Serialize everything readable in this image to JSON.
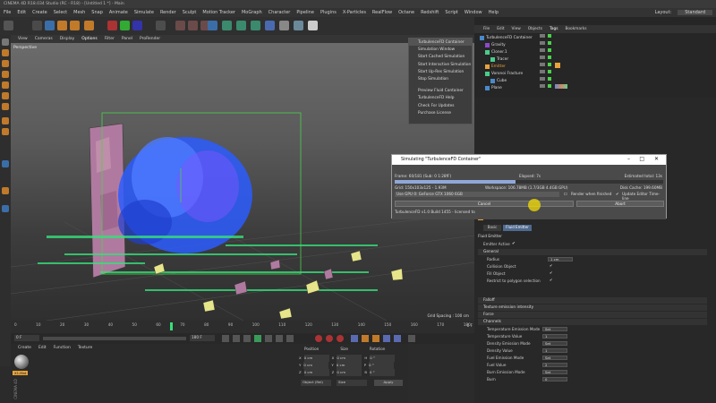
{
  "window": {
    "title": "CINEMA 4D R18.034 Studio (RC - R18) - [Untitled 1 *] - Main"
  },
  "menubar": [
    "File",
    "Edit",
    "Create",
    "Select",
    "Mesh",
    "Snap",
    "Animate",
    "Simulate",
    "Render",
    "Sculpt",
    "Motion Tracker",
    "MoGraph",
    "Character",
    "Pipeline",
    "Plugins",
    "X-Particles",
    "RealFlow",
    "Octane",
    "Redshift",
    "Script",
    "Window",
    "Help"
  ],
  "layout": {
    "label": "Layout:",
    "value": "Standard"
  },
  "viewport": {
    "menu": [
      "View",
      "Cameras",
      "Display",
      "Options",
      "Filter",
      "Panel",
      "ProRender"
    ],
    "label": "Perspective",
    "grid_spacing": "Grid Spacing : 100 cm"
  },
  "plugin_menu": {
    "items": [
      "TurbulenceFD Container",
      "Simulation Window",
      "Start Cached Simulation",
      "Start Interactive Simulation",
      "Start Up-Res Simulation",
      "Stop Simulation",
      "",
      "Preview Fluid Container",
      "TurbulenceFD Help",
      "Check For Updates",
      "Purchase License"
    ]
  },
  "timeline": {
    "ticks": [
      "0",
      "10",
      "20",
      "30",
      "40",
      "50",
      "60",
      "70",
      "80",
      "90",
      "100",
      "110",
      "120",
      "130",
      "140",
      "150",
      "160",
      "170",
      "180"
    ],
    "frame_readout": "0 F",
    "current": "0 F",
    "end": "180 F",
    "end2": "180 F"
  },
  "material": {
    "menu": [
      "Create",
      "Edit",
      "Function",
      "Texture"
    ],
    "mat_label": "X1.Mat",
    "logo": "CINEMA 4D"
  },
  "coords": {
    "headers": [
      "Position",
      "Size",
      "Rotation"
    ],
    "rows": [
      {
        "a": "X",
        "v1": "0 cm",
        "b": "X",
        "v2": "0 cm",
        "c": "H",
        "v3": "0 °"
      },
      {
        "a": "Y",
        "v1": "0 cm",
        "b": "Y",
        "v2": "0 cm",
        "c": "P",
        "v3": "0 °"
      },
      {
        "a": "Z",
        "v1": "0 cm",
        "b": "Z",
        "v2": "0 cm",
        "c": "B",
        "v3": "0 °"
      }
    ],
    "mode": "Object (Rel)",
    "size_mode": "Size",
    "apply": "Apply"
  },
  "objects": {
    "menu": [
      "File",
      "Edit",
      "View",
      "Objects",
      "Tags",
      "Bookmarks"
    ],
    "rows": [
      {
        "name": "TurbulenceFD Container",
        "indent": 0
      },
      {
        "name": "Gravity",
        "indent": 1
      },
      {
        "name": "Cloner.1",
        "indent": 1
      },
      {
        "name": "Tracer",
        "indent": 2
      },
      {
        "name": "Emitter",
        "indent": 1
      },
      {
        "name": "Voronoi Fracture",
        "indent": 1
      },
      {
        "name": "Cube",
        "indent": 2
      },
      {
        "name": "Plane",
        "indent": 1
      }
    ]
  },
  "dialog": {
    "title": "Simulating \"TurbulenceFD Container\"",
    "frame": "Frame: 60/181 (Sub: 0 1:28fF)",
    "elapsed": "Elapsed: 7s",
    "estimated": "Estimated total: 13s",
    "grid": "Grid: 150x103x125 - 1.93M",
    "workspace": "Workspace: 106.78MB (1.7/3GB 4.4GB GPU)",
    "disk": "Disk Cache: 199.60MB",
    "device": "Use GPU 0: GeForce GTX 1060 6GB",
    "render_label": "Render when finished",
    "update_label": "Update Editor Time-line",
    "build": "TurbulenceFD v1.0 Build 1455 - licensed to",
    "cancel": "Cancel",
    "abort": "Abort"
  },
  "attributes": {
    "header": "TurbulenceFD Emitter [TurbulenceFD Emitter]",
    "tabs": [
      "Basic",
      "Fluid Emitter"
    ],
    "section_title": "Fluid Emitter",
    "emitter_active": "Emitter Active",
    "groups": {
      "general": "General",
      "radius_label": "Radius",
      "radius_value": "1 cm",
      "collision": "Collision Object",
      "fill": "Fill Object",
      "restrict": "Restrict to polygon selection",
      "falloff": "Falloff",
      "texture": "Texture emission intensity",
      "force": "Force",
      "channels": "Channels"
    },
    "channels": [
      {
        "label": "Temperature Emission Mode",
        "value": "Set"
      },
      {
        "label": "Temperature Value",
        "value": "1"
      },
      {
        "label": "Density Emission Mode",
        "value": "Set"
      },
      {
        "label": "Density Value",
        "value": "1"
      },
      {
        "label": "Fuel Emission Mode",
        "value": "Set"
      },
      {
        "label": "Fuel Value",
        "value": "2"
      },
      {
        "label": "Burn Emission Mode",
        "value": "Set"
      },
      {
        "label": "Burn",
        "value": "0"
      }
    ]
  },
  "colors": {
    "accent": "#e8a33c",
    "selection": "#545454",
    "volume": "#2b5cff",
    "particles": "#36e07a"
  }
}
